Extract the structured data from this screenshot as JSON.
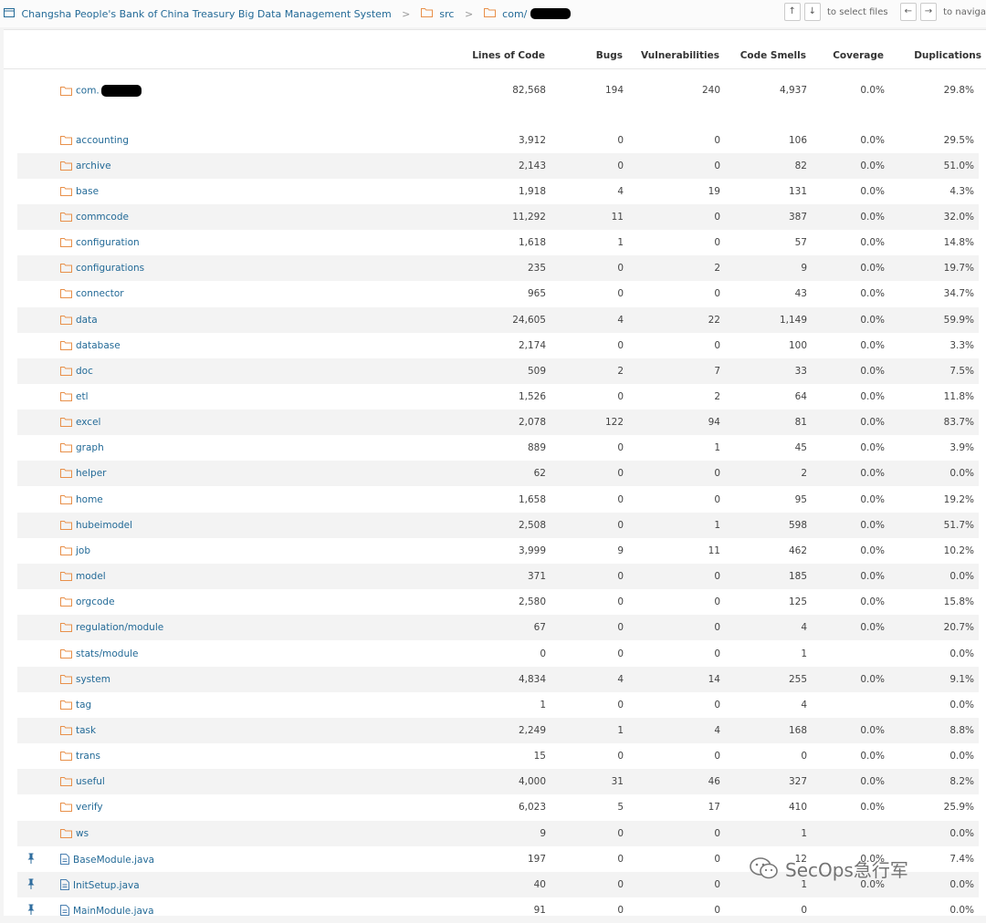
{
  "breadcrumb": {
    "project": "Changsha People's Bank of China Treasury Big Data Management System",
    "sep": ">",
    "src": "src",
    "pkg": "com/"
  },
  "controls": {
    "up": "↑",
    "down": "↓",
    "select_hint": "to select files",
    "left": "←",
    "right": "→",
    "navigate_hint": "to naviga"
  },
  "columns": {
    "loc": "Lines of Code",
    "bugs": "Bugs",
    "vulns": "Vulnerabilities",
    "smells": "Code Smells",
    "coverage": "Coverage",
    "dup": "Duplications"
  },
  "root": {
    "name": "com.",
    "loc": "82,568",
    "bugs": "194",
    "vulns": "240",
    "smells": "4,937",
    "coverage": "0.0%",
    "dup": "29.8%"
  },
  "rows": [
    {
      "type": "dir",
      "name": "accounting",
      "loc": "3,912",
      "bugs": "0",
      "vulns": "0",
      "smells": "106",
      "coverage": "0.0%",
      "dup": "29.5%"
    },
    {
      "type": "dir",
      "name": "archive",
      "loc": "2,143",
      "bugs": "0",
      "vulns": "0",
      "smells": "82",
      "coverage": "0.0%",
      "dup": "51.0%"
    },
    {
      "type": "dir",
      "name": "base",
      "loc": "1,918",
      "bugs": "4",
      "vulns": "19",
      "smells": "131",
      "coverage": "0.0%",
      "dup": "4.3%"
    },
    {
      "type": "dir",
      "name": "commcode",
      "loc": "11,292",
      "bugs": "11",
      "vulns": "0",
      "smells": "387",
      "coverage": "0.0%",
      "dup": "32.0%"
    },
    {
      "type": "dir",
      "name": "configuration",
      "loc": "1,618",
      "bugs": "1",
      "vulns": "0",
      "smells": "57",
      "coverage": "0.0%",
      "dup": "14.8%"
    },
    {
      "type": "dir",
      "name": "configurations",
      "loc": "235",
      "bugs": "0",
      "vulns": "2",
      "smells": "9",
      "coverage": "0.0%",
      "dup": "19.7%"
    },
    {
      "type": "dir",
      "name": "connector",
      "loc": "965",
      "bugs": "0",
      "vulns": "0",
      "smells": "43",
      "coverage": "0.0%",
      "dup": "34.7%"
    },
    {
      "type": "dir",
      "name": "data",
      "loc": "24,605",
      "bugs": "4",
      "vulns": "22",
      "smells": "1,149",
      "coverage": "0.0%",
      "dup": "59.9%"
    },
    {
      "type": "dir",
      "name": "database",
      "loc": "2,174",
      "bugs": "0",
      "vulns": "0",
      "smells": "100",
      "coverage": "0.0%",
      "dup": "3.3%"
    },
    {
      "type": "dir",
      "name": "doc",
      "loc": "509",
      "bugs": "2",
      "vulns": "7",
      "smells": "33",
      "coverage": "0.0%",
      "dup": "7.5%"
    },
    {
      "type": "dir",
      "name": "etl",
      "loc": "1,526",
      "bugs": "0",
      "vulns": "2",
      "smells": "64",
      "coverage": "0.0%",
      "dup": "11.8%"
    },
    {
      "type": "dir",
      "name": "excel",
      "loc": "2,078",
      "bugs": "122",
      "vulns": "94",
      "smells": "81",
      "coverage": "0.0%",
      "dup": "83.7%"
    },
    {
      "type": "dir",
      "name": "graph",
      "loc": "889",
      "bugs": "0",
      "vulns": "1",
      "smells": "45",
      "coverage": "0.0%",
      "dup": "3.9%"
    },
    {
      "type": "dir",
      "name": "helper",
      "loc": "62",
      "bugs": "0",
      "vulns": "0",
      "smells": "2",
      "coverage": "0.0%",
      "dup": "0.0%"
    },
    {
      "type": "dir",
      "name": "home",
      "loc": "1,658",
      "bugs": "0",
      "vulns": "0",
      "smells": "95",
      "coverage": "0.0%",
      "dup": "19.2%"
    },
    {
      "type": "dir",
      "name": "hubeimodel",
      "loc": "2,508",
      "bugs": "0",
      "vulns": "1",
      "smells": "598",
      "coverage": "0.0%",
      "dup": "51.7%"
    },
    {
      "type": "dir",
      "name": "job",
      "loc": "3,999",
      "bugs": "9",
      "vulns": "11",
      "smells": "462",
      "coverage": "0.0%",
      "dup": "10.2%"
    },
    {
      "type": "dir",
      "name": "model",
      "loc": "371",
      "bugs": "0",
      "vulns": "0",
      "smells": "185",
      "coverage": "0.0%",
      "dup": "0.0%"
    },
    {
      "type": "dir",
      "name": "orgcode",
      "loc": "2,580",
      "bugs": "0",
      "vulns": "0",
      "smells": "125",
      "coverage": "0.0%",
      "dup": "15.8%"
    },
    {
      "type": "dir",
      "name": "regulation/module",
      "loc": "67",
      "bugs": "0",
      "vulns": "0",
      "smells": "4",
      "coverage": "0.0%",
      "dup": "20.7%"
    },
    {
      "type": "dir",
      "name": "stats/module",
      "loc": "0",
      "bugs": "0",
      "vulns": "0",
      "smells": "1",
      "coverage": "",
      "dup": "0.0%"
    },
    {
      "type": "dir",
      "name": "system",
      "loc": "4,834",
      "bugs": "4",
      "vulns": "14",
      "smells": "255",
      "coverage": "0.0%",
      "dup": "9.1%"
    },
    {
      "type": "dir",
      "name": "tag",
      "loc": "1",
      "bugs": "0",
      "vulns": "0",
      "smells": "4",
      "coverage": "",
      "dup": "0.0%"
    },
    {
      "type": "dir",
      "name": "task",
      "loc": "2,249",
      "bugs": "1",
      "vulns": "4",
      "smells": "168",
      "coverage": "0.0%",
      "dup": "8.8%"
    },
    {
      "type": "dir",
      "name": "trans",
      "loc": "15",
      "bugs": "0",
      "vulns": "0",
      "smells": "0",
      "coverage": "0.0%",
      "dup": "0.0%"
    },
    {
      "type": "dir",
      "name": "useful",
      "loc": "4,000",
      "bugs": "31",
      "vulns": "46",
      "smells": "327",
      "coverage": "0.0%",
      "dup": "8.2%"
    },
    {
      "type": "dir",
      "name": "verify",
      "loc": "6,023",
      "bugs": "5",
      "vulns": "17",
      "smells": "410",
      "coverage": "0.0%",
      "dup": "25.9%"
    },
    {
      "type": "dir",
      "name": "ws",
      "loc": "9",
      "bugs": "0",
      "vulns": "0",
      "smells": "1",
      "coverage": "",
      "dup": "0.0%"
    },
    {
      "type": "file",
      "name": "BaseModule.java",
      "loc": "197",
      "bugs": "0",
      "vulns": "0",
      "smells": "12",
      "coverage": "0.0%",
      "dup": "7.4%"
    },
    {
      "type": "file",
      "name": "InitSetup.java",
      "loc": "40",
      "bugs": "0",
      "vulns": "0",
      "smells": "1",
      "coverage": "0.0%",
      "dup": "0.0%"
    },
    {
      "type": "file",
      "name": "MainModule.java",
      "loc": "91",
      "bugs": "0",
      "vulns": "0",
      "smells": "0",
      "coverage": "",
      "dup": "0.0%"
    }
  ],
  "watermark": "SecOps急行军",
  "colors": {
    "link": "#236a97",
    "folder": "#e8904a",
    "file": "#4a7fb0",
    "stripe": "#f3f3f3",
    "pin": "#2e6c9e"
  }
}
